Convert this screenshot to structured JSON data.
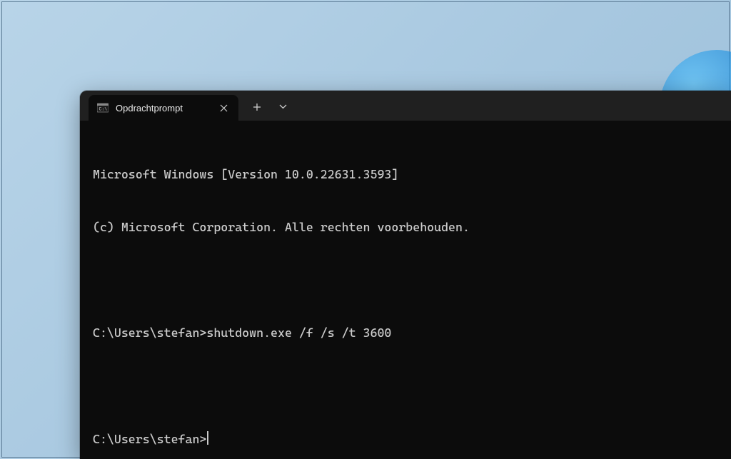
{
  "tab": {
    "title": "Opdrachtprompt"
  },
  "terminal": {
    "line1": "Microsoft Windows [Version 10.0.22631.3593]",
    "line2": "(c) Microsoft Corporation. Alle rechten voorbehouden.",
    "blank1": " ",
    "prompt1": "C:\\Users\\stefan>",
    "command1": "shutdown.exe /f /s /t 3600",
    "blank2": " ",
    "prompt2": "C:\\Users\\stefan>"
  }
}
